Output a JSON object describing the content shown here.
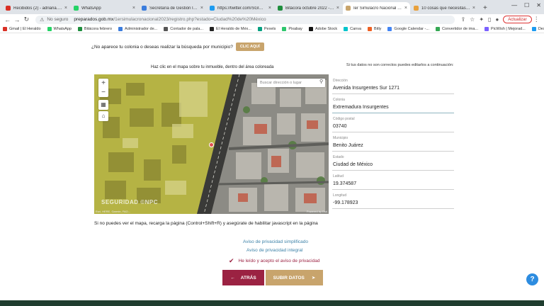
{
  "browser": {
    "tabs": [
      {
        "label": "Recibidos (2) - adriana.juare",
        "color": "#d93025"
      },
      {
        "label": "WhatsApp",
        "color": "#25d366"
      },
      {
        "label": "Secretaría de Gestión Integral",
        "color": "#3b7ddd"
      },
      {
        "label": "https://twitter.com/SGIRPC_CI",
        "color": "#1d9bf0"
      },
      {
        "label": "Bitácora octubre 2022 -Ibop",
        "color": "#1e8e3e"
      },
      {
        "label": "Ier Simulacro Nacional 2023",
        "color": "#c8a46c",
        "active": true
      },
      {
        "label": "10 cosas que necesitas saber",
        "color": "#e8a03c"
      }
    ],
    "new_tab": "+",
    "address": {
      "security": "No seguro",
      "host": "preparados.gob.mx",
      "path": "/1ersimulacronacional2023/registro.php?estado=Ciudad%20de%20México"
    },
    "update_button": "Actualizar",
    "bookmarks": [
      {
        "label": "Gmail | El Heraldo",
        "color": "#d93025"
      },
      {
        "label": "WhatsApp",
        "color": "#25d366"
      },
      {
        "label": "Bitácora febrero",
        "color": "#1e8e3e"
      },
      {
        "label": "Administrador de...",
        "color": "#3b7ddd"
      },
      {
        "label": "Contador de pala...",
        "color": "#555555"
      },
      {
        "label": "El Heraldo de Méx...",
        "color": "#222222"
      },
      {
        "label": "Pexels",
        "color": "#05a081"
      },
      {
        "label": "Pixabay",
        "color": "#2ec66d"
      },
      {
        "label": "Adobe Stock",
        "color": "#111111"
      },
      {
        "label": "Canva",
        "color": "#00c4cc"
      },
      {
        "label": "Bitly",
        "color": "#ee6123"
      },
      {
        "label": "Google Calendar -...",
        "color": "#4285f4"
      },
      {
        "label": "Convertidor de ima...",
        "color": "#34a853"
      },
      {
        "label": "PicWish | Mejorad...",
        "color": "#7b61ff"
      },
      {
        "label": "Descargar Twitter",
        "color": "#1d9bf0"
      }
    ]
  },
  "page": {
    "colonia_question": "¿No aparece tu colonia o deseas realizar la búsqueda por municipio?",
    "clic_button": "CLIC AQUÍ",
    "map_title": "Haz clic en el mapa sobre tu inmueble, dentro del área coloreada",
    "map": {
      "search_placeholder": "Buscar dirección o lugar",
      "zoom_in": "+",
      "zoom_out": "−",
      "watermark": "SEGURIDAD   ©NPC",
      "attribution_left": "Esri, HERE, Garmin, FAO...",
      "attribution_right": "Powered by Esri"
    },
    "form_note": "Si tus datos no son correctos puedes editarlos a continuación:",
    "fields": [
      {
        "label": "Dirección",
        "value": "Avenida Insurgentes Sur 1271"
      },
      {
        "label": "Colonia",
        "value": "Extremadura Insurgentes",
        "focused": true
      },
      {
        "label": "Código postal",
        "value": "03740"
      },
      {
        "label": "Municipio",
        "value": "Benito Juárez"
      },
      {
        "label": "Estado",
        "value": "Ciudad de México"
      },
      {
        "label": "Latitud",
        "value": "19.374587"
      },
      {
        "label": "Longitud",
        "value": "-99.178923"
      }
    ],
    "js_note": "Si no puedes ver el mapa, recarga la página (Control+Shift+R) y asegúrate de habilitar javascript en la página",
    "privacy_simplified": "Aviso de privacidad simplificado",
    "privacy_full": "Aviso de privacidad integral",
    "accept_privacy": "He leído y acepto el aviso de privacidad",
    "back_button": "ATRÁS",
    "submit_button": "SUBIR DATOS",
    "help_button": "?"
  },
  "colors": {
    "primary": "#9b2242",
    "gold": "#c8a46c",
    "link": "#3d82a8",
    "footer": "#1f3d2f"
  }
}
